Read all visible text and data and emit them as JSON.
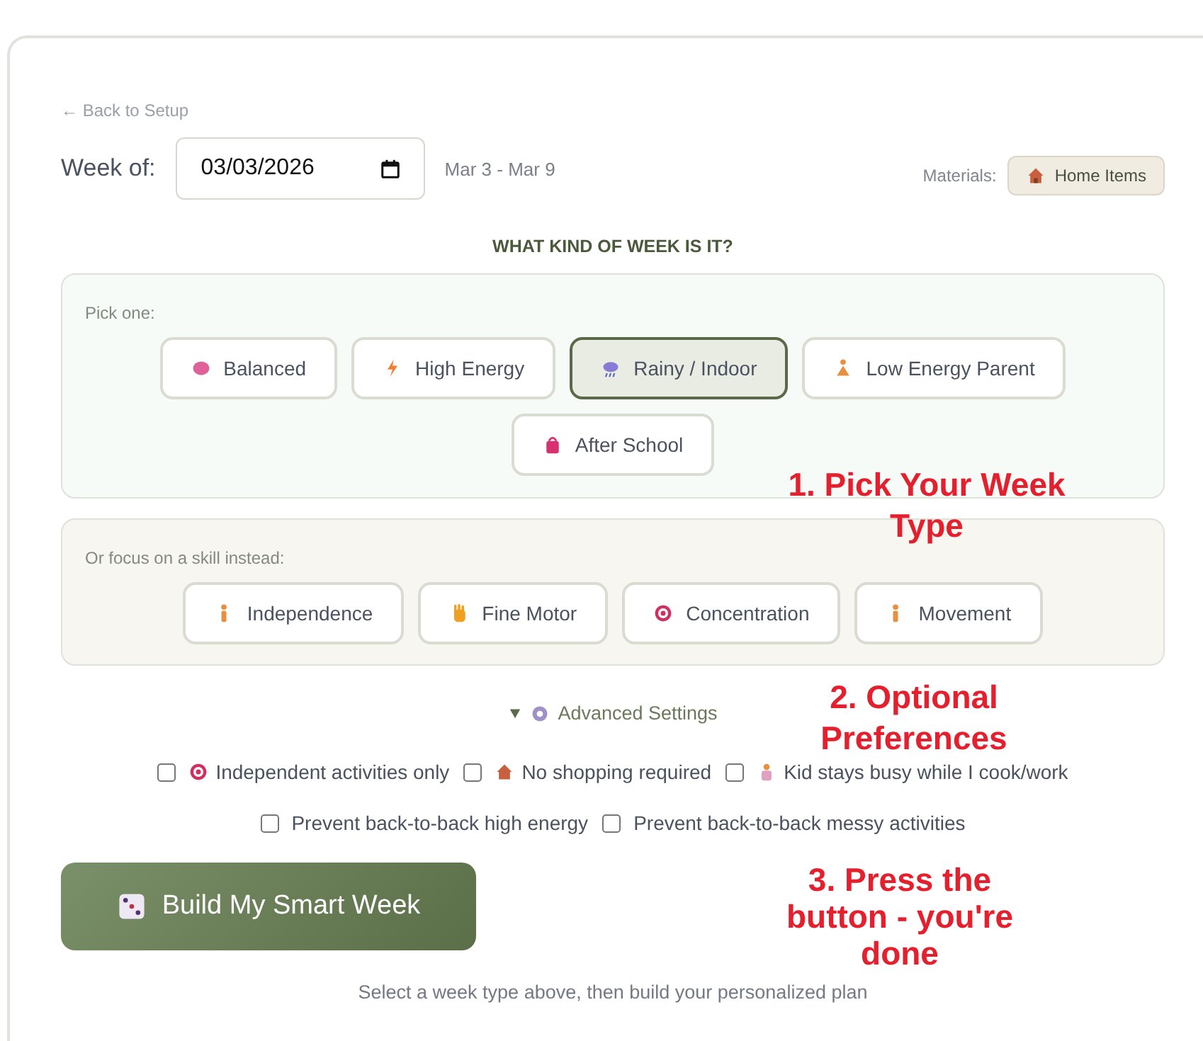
{
  "back_link": "← Back to Setup",
  "week": {
    "label": "Week of:",
    "value": "03/03/2026",
    "range": "Mar 3 - Mar 9"
  },
  "materials": {
    "label": "Materials:",
    "badge": "Home Items"
  },
  "heading": "WHAT KIND OF WEEK IS IT?",
  "week_types": {
    "label": "Pick one:",
    "options": [
      {
        "label": "Balanced",
        "selected": false
      },
      {
        "label": "High Energy",
        "selected": false
      },
      {
        "label": "Rainy / Indoor",
        "selected": true
      },
      {
        "label": "Low Energy Parent",
        "selected": false
      },
      {
        "label": "After School",
        "selected": false
      }
    ]
  },
  "skills": {
    "label": "Or focus on a skill instead:",
    "options": [
      {
        "label": "Independence",
        "selected": false
      },
      {
        "label": "Fine Motor",
        "selected": false
      },
      {
        "label": "Concentration",
        "selected": false
      },
      {
        "label": "Movement",
        "selected": false
      }
    ]
  },
  "advanced": {
    "label": "Advanced Settings",
    "expanded": true,
    "rows": [
      [
        {
          "label": "Independent activities only",
          "checked": false
        },
        {
          "label": "No shopping required",
          "checked": false
        },
        {
          "label": "Kid stays busy while I cook/work",
          "checked": false
        }
      ],
      [
        {
          "label": "Prevent back-to-back high energy",
          "checked": false
        },
        {
          "label": "Prevent back-to-back messy activities",
          "checked": false
        }
      ]
    ]
  },
  "build_button": "Build My Smart Week",
  "hint": "Select a week type above, then build your personalized plan",
  "annotations": [
    "1. Pick Your Week Type",
    "2. Optional Preferences",
    "3. Press the button - you're done"
  ]
}
